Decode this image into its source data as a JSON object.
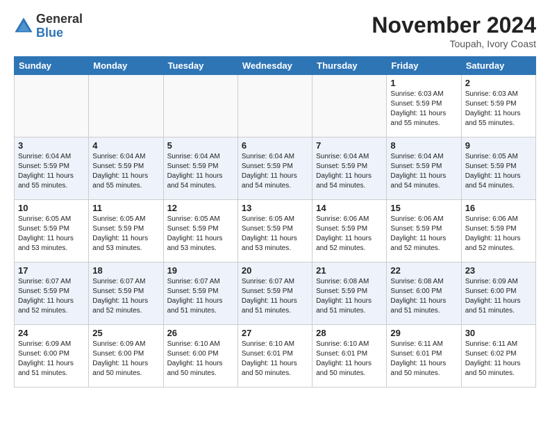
{
  "header": {
    "logo_general": "General",
    "logo_blue": "Blue",
    "month_title": "November 2024",
    "location": "Toupah, Ivory Coast"
  },
  "weekdays": [
    "Sunday",
    "Monday",
    "Tuesday",
    "Wednesday",
    "Thursday",
    "Friday",
    "Saturday"
  ],
  "weeks": [
    [
      {
        "day": "",
        "info": ""
      },
      {
        "day": "",
        "info": ""
      },
      {
        "day": "",
        "info": ""
      },
      {
        "day": "",
        "info": ""
      },
      {
        "day": "",
        "info": ""
      },
      {
        "day": "1",
        "info": "Sunrise: 6:03 AM\nSunset: 5:59 PM\nDaylight: 11 hours\nand 55 minutes."
      },
      {
        "day": "2",
        "info": "Sunrise: 6:03 AM\nSunset: 5:59 PM\nDaylight: 11 hours\nand 55 minutes."
      }
    ],
    [
      {
        "day": "3",
        "info": "Sunrise: 6:04 AM\nSunset: 5:59 PM\nDaylight: 11 hours\nand 55 minutes."
      },
      {
        "day": "4",
        "info": "Sunrise: 6:04 AM\nSunset: 5:59 PM\nDaylight: 11 hours\nand 55 minutes."
      },
      {
        "day": "5",
        "info": "Sunrise: 6:04 AM\nSunset: 5:59 PM\nDaylight: 11 hours\nand 54 minutes."
      },
      {
        "day": "6",
        "info": "Sunrise: 6:04 AM\nSunset: 5:59 PM\nDaylight: 11 hours\nand 54 minutes."
      },
      {
        "day": "7",
        "info": "Sunrise: 6:04 AM\nSunset: 5:59 PM\nDaylight: 11 hours\nand 54 minutes."
      },
      {
        "day": "8",
        "info": "Sunrise: 6:04 AM\nSunset: 5:59 PM\nDaylight: 11 hours\nand 54 minutes."
      },
      {
        "day": "9",
        "info": "Sunrise: 6:05 AM\nSunset: 5:59 PM\nDaylight: 11 hours\nand 54 minutes."
      }
    ],
    [
      {
        "day": "10",
        "info": "Sunrise: 6:05 AM\nSunset: 5:59 PM\nDaylight: 11 hours\nand 53 minutes."
      },
      {
        "day": "11",
        "info": "Sunrise: 6:05 AM\nSunset: 5:59 PM\nDaylight: 11 hours\nand 53 minutes."
      },
      {
        "day": "12",
        "info": "Sunrise: 6:05 AM\nSunset: 5:59 PM\nDaylight: 11 hours\nand 53 minutes."
      },
      {
        "day": "13",
        "info": "Sunrise: 6:05 AM\nSunset: 5:59 PM\nDaylight: 11 hours\nand 53 minutes."
      },
      {
        "day": "14",
        "info": "Sunrise: 6:06 AM\nSunset: 5:59 PM\nDaylight: 11 hours\nand 52 minutes."
      },
      {
        "day": "15",
        "info": "Sunrise: 6:06 AM\nSunset: 5:59 PM\nDaylight: 11 hours\nand 52 minutes."
      },
      {
        "day": "16",
        "info": "Sunrise: 6:06 AM\nSunset: 5:59 PM\nDaylight: 11 hours\nand 52 minutes."
      }
    ],
    [
      {
        "day": "17",
        "info": "Sunrise: 6:07 AM\nSunset: 5:59 PM\nDaylight: 11 hours\nand 52 minutes."
      },
      {
        "day": "18",
        "info": "Sunrise: 6:07 AM\nSunset: 5:59 PM\nDaylight: 11 hours\nand 52 minutes."
      },
      {
        "day": "19",
        "info": "Sunrise: 6:07 AM\nSunset: 5:59 PM\nDaylight: 11 hours\nand 51 minutes."
      },
      {
        "day": "20",
        "info": "Sunrise: 6:07 AM\nSunset: 5:59 PM\nDaylight: 11 hours\nand 51 minutes."
      },
      {
        "day": "21",
        "info": "Sunrise: 6:08 AM\nSunset: 5:59 PM\nDaylight: 11 hours\nand 51 minutes."
      },
      {
        "day": "22",
        "info": "Sunrise: 6:08 AM\nSunset: 6:00 PM\nDaylight: 11 hours\nand 51 minutes."
      },
      {
        "day": "23",
        "info": "Sunrise: 6:09 AM\nSunset: 6:00 PM\nDaylight: 11 hours\nand 51 minutes."
      }
    ],
    [
      {
        "day": "24",
        "info": "Sunrise: 6:09 AM\nSunset: 6:00 PM\nDaylight: 11 hours\nand 51 minutes."
      },
      {
        "day": "25",
        "info": "Sunrise: 6:09 AM\nSunset: 6:00 PM\nDaylight: 11 hours\nand 50 minutes."
      },
      {
        "day": "26",
        "info": "Sunrise: 6:10 AM\nSunset: 6:00 PM\nDaylight: 11 hours\nand 50 minutes."
      },
      {
        "day": "27",
        "info": "Sunrise: 6:10 AM\nSunset: 6:01 PM\nDaylight: 11 hours\nand 50 minutes."
      },
      {
        "day": "28",
        "info": "Sunrise: 6:10 AM\nSunset: 6:01 PM\nDaylight: 11 hours\nand 50 minutes."
      },
      {
        "day": "29",
        "info": "Sunrise: 6:11 AM\nSunset: 6:01 PM\nDaylight: 11 hours\nand 50 minutes."
      },
      {
        "day": "30",
        "info": "Sunrise: 6:11 AM\nSunset: 6:02 PM\nDaylight: 11 hours\nand 50 minutes."
      }
    ]
  ]
}
